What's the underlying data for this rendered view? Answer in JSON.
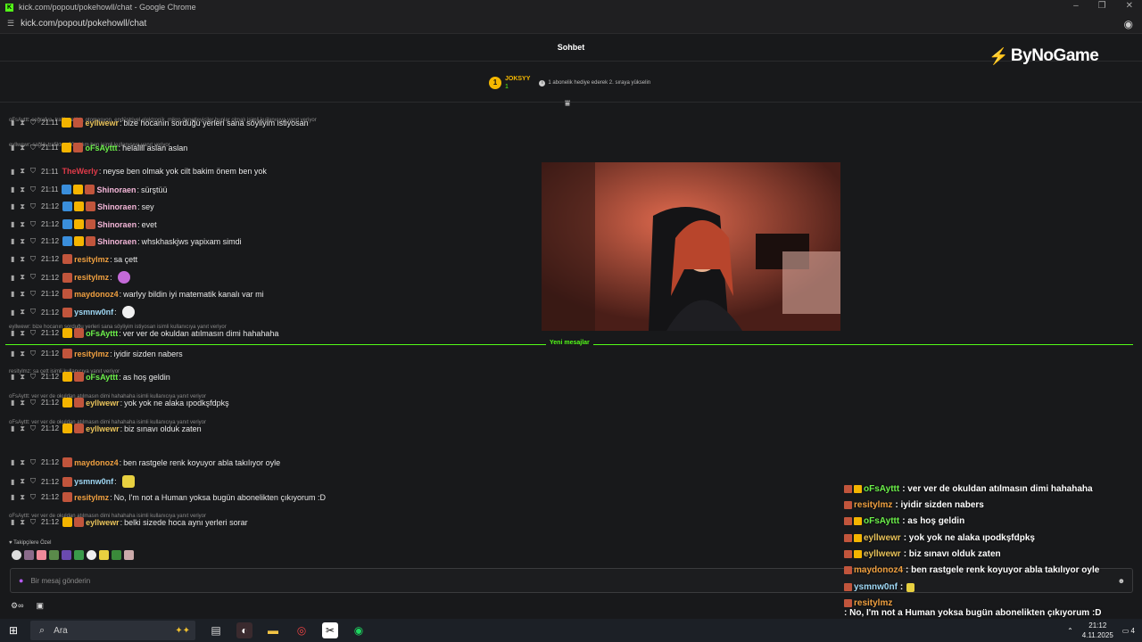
{
  "window": {
    "title": "kick.com/popout/pokehowll/chat - Google Chrome",
    "url": "kick.com/popout/pokehowll/chat"
  },
  "header": {
    "title": "Sohbet"
  },
  "brand": {
    "name": "ByNoGame"
  },
  "leaderboard": {
    "rank": "1",
    "username": "JOKSYY",
    "count": "1",
    "info": "1 abonelik hediye ederek 2. sıraya yükselin"
  },
  "messages": [
    {
      "reply": "oFsAyttt: coğrafya, trafik-sağlık, otomasyon, endüstriyel elektronik, mikro denetleyiciler bunlar olmalı isimli kullanıcıya yanıt veriyor",
      "time": "21:11",
      "user": "eyllwewr",
      "color": "#e8c25a",
      "text": "bize hocanın sorduğu yerleri sana söyliyim istiyosan"
    },
    {
      "reply": "eyllwewr: sağlık trafikten 90 aldım ben isimli kullanıcıya yanıt veriyor",
      "time": "21:11",
      "user": "oFsAyttt",
      "color": "#6cf04a",
      "text": "helallll aslan aslan"
    },
    {
      "reply": "",
      "time": "21:11",
      "user": "TheWerly",
      "color": "#e23b4a",
      "text": "neyse ben olmak yok cilt bakim önem ben yok"
    },
    {
      "reply": "",
      "time": "21:11",
      "user": "Shinoraen",
      "color": "#f3b6d8",
      "text": "sürştüü"
    },
    {
      "reply": "",
      "time": "21:12",
      "user": "Shinoraen",
      "color": "#f3b6d8",
      "text": "sey"
    },
    {
      "reply": "",
      "time": "21:12",
      "user": "Shinoraen",
      "color": "#f3b6d8",
      "text": "evet"
    },
    {
      "reply": "",
      "time": "21:12",
      "user": "Shinoraen",
      "color": "#f3b6d8",
      "text": "whskhaskjws yapixam simdi"
    },
    {
      "reply": "",
      "time": "21:12",
      "user": "resitylmz",
      "color": "#f0a040",
      "text": "sa çett"
    },
    {
      "reply": "",
      "time": "21:12",
      "user": "resitylmz",
      "color": "#f0a040",
      "text": ""
    },
    {
      "reply": "",
      "time": "21:12",
      "user": "maydonoz4",
      "color": "#f0a040",
      "text": "warlyy bildin iyi matematik kanalı var mi"
    },
    {
      "reply": "",
      "time": "21:12",
      "user": "ysmnw0nf",
      "color": "#9fd8f5",
      "text": ""
    },
    {
      "reply": "eyllwewr: bize hocanın sorduğu yerleri sana söyliyim istiyosan isimli kullanıcıya yanıt veriyor",
      "time": "21:12",
      "user": "oFsAyttt",
      "color": "#6cf04a",
      "text": "ver ver de okuldan atılmasın dimi hahahaha"
    },
    {
      "reply": "",
      "time": "21:12",
      "user": "resitylmz",
      "color": "#f0a040",
      "text": "iyidir sizden nabers"
    },
    {
      "reply": "resitylmz: sa çett isimli kullanıcıya yanıt veriyor",
      "time": "21:12",
      "user": "oFsAyttt",
      "color": "#6cf04a",
      "text": "as hoş geldin"
    },
    {
      "reply": "oFsAyttt: ver ver de okuldan atılmasın dimi hahahaha isimli kullanıcıya yanıt veriyor",
      "time": "21:12",
      "user": "eyllwewr",
      "color": "#e8c25a",
      "text": "yok yok ne alaka ıpodkşfdpkş"
    },
    {
      "reply": "oFsAyttt: ver ver de okuldan atılmasın dimi hahahaha isimli kullanıcıya yanıt veriyor",
      "time": "21:12",
      "user": "eyllwewr",
      "color": "#e8c25a",
      "text": "biz sınavı olduk zaten"
    },
    {
      "reply": "",
      "time": "21:12",
      "user": "maydonoz4",
      "color": "#f0a040",
      "text": "ben rastgele renk koyuyor abla takılıyor oyle"
    },
    {
      "reply": "",
      "time": "21:12",
      "user": "ysmnw0nf",
      "color": "#9fd8f5",
      "text": ""
    },
    {
      "reply": "",
      "time": "21:12",
      "user": "resitylmz",
      "color": "#f0a040",
      "text": "No, I'm not a Human yoksa bugün abonelikten çıkıyorum :D"
    },
    {
      "reply": "oFsAyttt: ver ver de okuldan atılmasın dimi hahahaha isimli kullanıcıya yanıt veriyor",
      "time": "21:12",
      "user": "eyllwewr",
      "color": "#e8c25a",
      "text": "belki sizede hoca aynı yerleri sorar"
    }
  ],
  "divider": {
    "label": "Yeni mesajlar"
  },
  "followers": {
    "label": "Takipçilere Özel"
  },
  "input": {
    "placeholder": "Bir mesaj gönderin"
  },
  "overlay": [
    {
      "user": "oFsAyttt",
      "color": "#6cf04a",
      "text": ": ver ver de okuldan atılmasın dimi hahahaha"
    },
    {
      "user": "resitylmz",
      "color": "#f0a040",
      "text": ": iyidir sizden nabers"
    },
    {
      "user": "oFsAyttt",
      "color": "#6cf04a",
      "text": ": as hoş geldin"
    },
    {
      "user": "eyllwewr",
      "color": "#e8c25a",
      "text": ": yok yok ne alaka ıpodkşfdpkş"
    },
    {
      "user": "eyllwewr",
      "color": "#e8c25a",
      "text": ": biz sınavı olduk zaten"
    },
    {
      "user": "maydonoz4",
      "color": "#f0a040",
      "text": ": ben rastgele renk koyuyor abla takılıyor oyle"
    },
    {
      "user": "ysmnw0nf",
      "color": "#9fd8f5",
      "text": ":"
    },
    {
      "user": "resitylmz",
      "color": "#f0a040",
      "text": ": No, I'm not a Human yoksa bugün abonelikten çıkıyorum :D"
    },
    {
      "user": "eyllwewr",
      "color": "#e8c25a",
      "text": ": belki sizede hoca aynı yerleri sorar"
    }
  ],
  "taskbar": {
    "search_label": "Ara",
    "time": "21:12",
    "date": "4.11.2025",
    "notif_count": "4"
  },
  "colors": {
    "accent": "#53fc18",
    "background": "#18191b"
  }
}
